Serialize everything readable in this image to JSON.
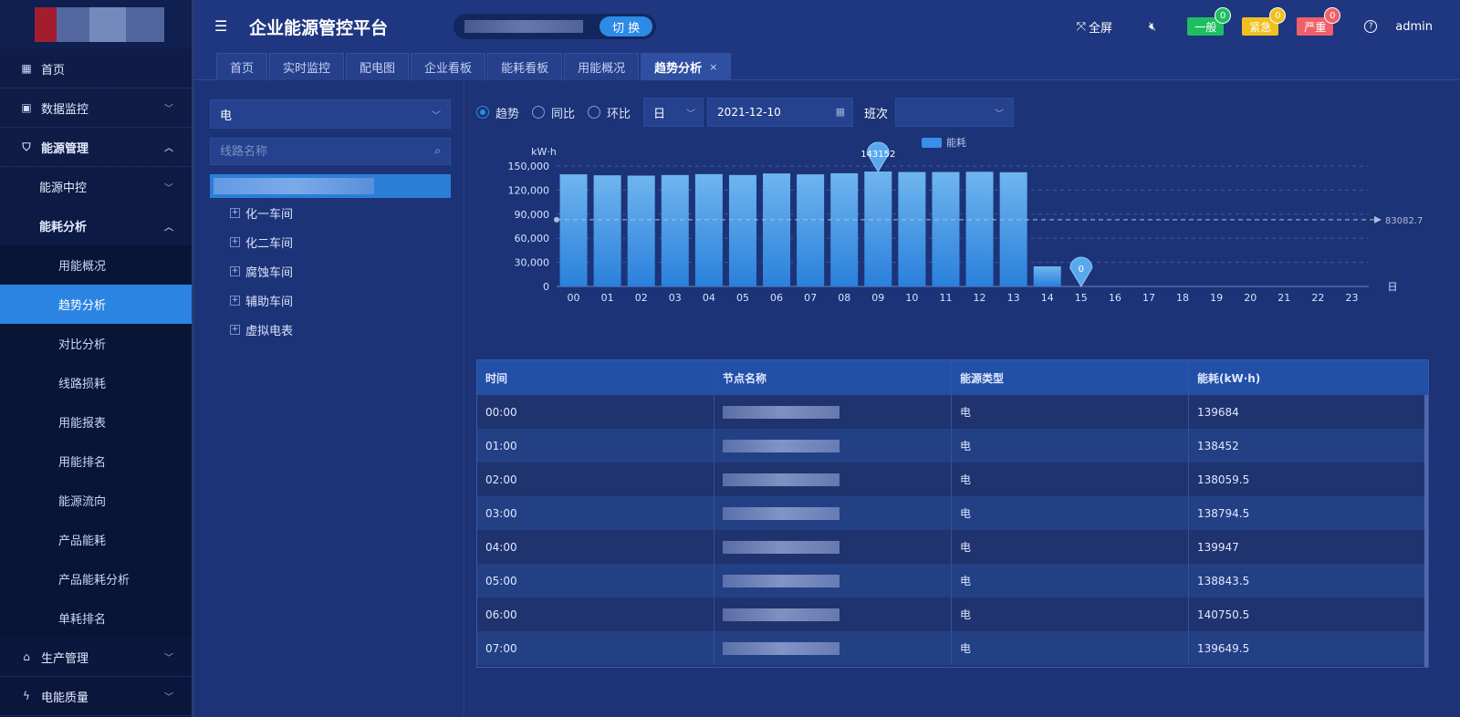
{
  "header": {
    "title": "企业能源管控平台",
    "switch_label": "切 换",
    "fullscreen_label": "全屏",
    "alarms": [
      {
        "label": "一般",
        "count": "0",
        "color": "#1fbf5f"
      },
      {
        "label": "紧急",
        "count": "0",
        "color": "#f0c020"
      },
      {
        "label": "严重",
        "count": "0",
        "color": "#f0606a"
      }
    ],
    "user": "admin"
  },
  "sidebar": {
    "items": [
      {
        "label": "首页",
        "icon": "home-icon",
        "level": 1
      },
      {
        "label": "数据监控",
        "icon": "monitor-icon",
        "level": 1,
        "chevron": "down"
      },
      {
        "label": "能源管理",
        "icon": "shield-icon",
        "level": 1,
        "chevron": "up",
        "bold": true
      },
      {
        "label": "能源中控",
        "level": 2,
        "chevron": "down"
      },
      {
        "label": "能耗分析",
        "level": 2,
        "chevron": "up",
        "bold": true
      },
      {
        "label": "用能概况",
        "level": 3
      },
      {
        "label": "趋势分析",
        "level": 3,
        "active": true
      },
      {
        "label": "对比分析",
        "level": 3
      },
      {
        "label": "线路损耗",
        "level": 3
      },
      {
        "label": "用能报表",
        "level": 3
      },
      {
        "label": "用能排名",
        "level": 3
      },
      {
        "label": "能源流向",
        "level": 3
      },
      {
        "label": "产品能耗",
        "level": 3
      },
      {
        "label": "产品能耗分析",
        "level": 3
      },
      {
        "label": "单耗排名",
        "level": 3
      },
      {
        "label": "生产管理",
        "icon": "factory-icon",
        "level": 1,
        "chevron": "down"
      },
      {
        "label": "电能质量",
        "icon": "power-icon",
        "level": 1,
        "chevron": "down"
      }
    ]
  },
  "tabs": [
    {
      "label": "首页"
    },
    {
      "label": "实时监控"
    },
    {
      "label": "配电图"
    },
    {
      "label": "企业看板"
    },
    {
      "label": "能耗看板"
    },
    {
      "label": "用能概况"
    },
    {
      "label": "趋势分析",
      "active": true
    }
  ],
  "tree": {
    "energy_type": "电",
    "search_placeholder": "线路名称",
    "nodes": [
      "化一车间",
      "化二车间",
      "腐蚀车间",
      "辅助车间",
      "虚拟电表"
    ]
  },
  "filters": {
    "radios": [
      {
        "label": "趋势",
        "checked": true
      },
      {
        "label": "同比",
        "checked": false
      },
      {
        "label": "环比",
        "checked": false
      }
    ],
    "period": "日",
    "date": "2021-12-10",
    "shift_label": "班次",
    "shift_value": ""
  },
  "chart_data": {
    "type": "bar",
    "ylabel": "kW·h",
    "xlabel": "日",
    "legend": "能耗",
    "legend_position": "top-center",
    "categories": [
      "00",
      "01",
      "02",
      "03",
      "04",
      "05",
      "06",
      "07",
      "08",
      "09",
      "10",
      "11",
      "12",
      "13",
      "14",
      "15",
      "16",
      "17",
      "18",
      "19",
      "20",
      "21",
      "22",
      "23"
    ],
    "values": [
      139684,
      138452,
      138059.5,
      138794.5,
      139947,
      138843.5,
      140750.5,
      139649.5,
      141000,
      143152,
      142500,
      142600,
      142800,
      142200,
      25000,
      0,
      null,
      null,
      null,
      null,
      null,
      null,
      null,
      null
    ],
    "ylim": [
      0,
      150000
    ],
    "yticks": [
      0,
      30000,
      60000,
      90000,
      120000,
      150000
    ],
    "ytick_labels": [
      "0",
      "30,000",
      "60,000",
      "90,000",
      "120,000",
      "150,000"
    ],
    "markers": [
      {
        "label": "143152",
        "x": "09",
        "value": 143152
      },
      {
        "label": "0",
        "x": "15",
        "value": 0
      }
    ],
    "average_line": {
      "value": 83082.7,
      "label": "83082.7"
    },
    "grid": true
  },
  "table": {
    "columns": [
      "时间",
      "节点名称",
      "能源类型",
      "能耗(kW·h)"
    ],
    "rows": [
      [
        "00:00",
        "",
        "电",
        "139684"
      ],
      [
        "01:00",
        "",
        "电",
        "138452"
      ],
      [
        "02:00",
        "",
        "电",
        "138059.5"
      ],
      [
        "03:00",
        "",
        "电",
        "138794.5"
      ],
      [
        "04:00",
        "",
        "电",
        "139947"
      ],
      [
        "05:00",
        "",
        "电",
        "138843.5"
      ],
      [
        "06:00",
        "",
        "电",
        "140750.5"
      ],
      [
        "07:00",
        "",
        "电",
        "139649.5"
      ]
    ]
  },
  "colors": {
    "accent": "#2d8be6",
    "bar_top": "#6fb5ef",
    "bar_bottom": "#2a80dc"
  }
}
